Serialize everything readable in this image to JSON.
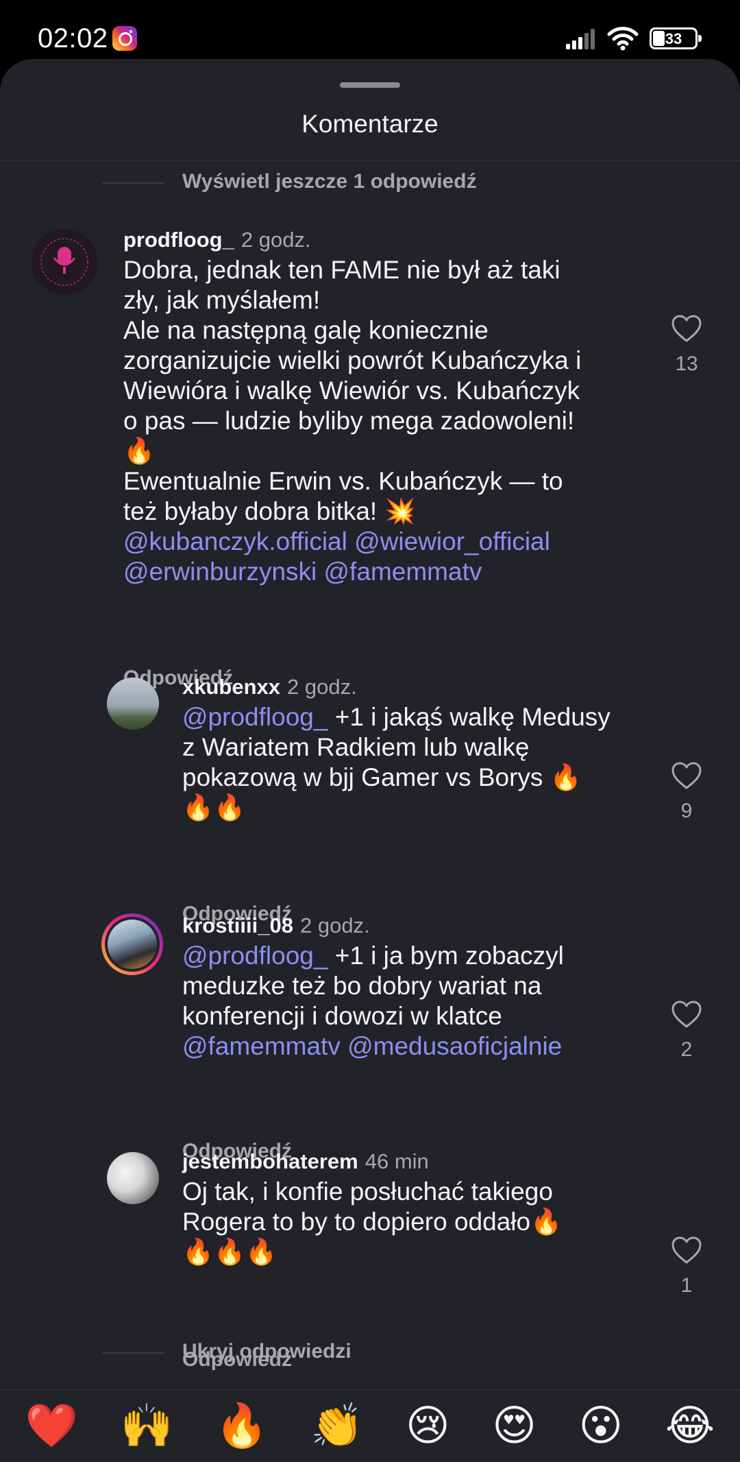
{
  "status_bar": {
    "time": "02:02",
    "battery": "33"
  },
  "sheet": {
    "title": "Komentarze"
  },
  "view_more": "Wyświetl jeszcze 1 odpowiedź",
  "hide_replies": "Ukryj odpowiedzi",
  "comments": [
    {
      "username": "prodfloog_",
      "time": "2 godz.",
      "lines": [
        {
          "text": "Dobra, jednak ten FAME nie był aż taki"
        },
        {
          "text": "zły, jak myślałem!"
        },
        {
          "text": "Ale na następną galę koniecznie"
        },
        {
          "text": "zorganizujcie wielki powrót Kubańczyka i"
        },
        {
          "text": "Wiewióra i walkę Wiewiór vs. Kubańczyk"
        },
        {
          "text": "o pas — ludzie byliby mega zadowoleni!"
        },
        {
          "text": "🔥"
        },
        {
          "text": "Ewentualnie Erwin vs. Kubańczyk — to"
        },
        {
          "text": "też byłaby dobra  bitka! 💥"
        },
        {
          "text": "@kubanczyk.official @wiewior_official",
          "mention": true
        },
        {
          "text": "@erwinburzynski @famemmatv",
          "mention": true
        }
      ],
      "reply_label": "Odpowiedź",
      "likes": "13"
    },
    {
      "username": "xkubenxx",
      "time": "2 godz.",
      "mention": "@prodfloog_",
      "lines": [
        {
          "text": " +1 i jakąś walkę Medusy"
        },
        {
          "text": "z Wariatem Radkiem lub walkę"
        },
        {
          "text": "pokazową w bjj Gamer vs Borys 🔥"
        },
        {
          "text": "🔥🔥"
        }
      ],
      "reply_label": "Odpowiedź",
      "likes": "9"
    },
    {
      "username": "krostiiii_08",
      "time": "2 godz.",
      "mention": "@prodfloog_",
      "lines": [
        {
          "text": " +1 i ja bym zobaczyl"
        },
        {
          "text": "meduzke też bo dobry wariat na"
        },
        {
          "text": "konferencji i dowozi w klatce"
        },
        {
          "text": "@famemmatv @medusaoficjalnie",
          "mention": true
        }
      ],
      "reply_label": "Odpowiedź",
      "likes": "2"
    },
    {
      "username": "jestembohaterem",
      "time": "46 min",
      "lines": [
        {
          "text": "Oj tak, i konfie posłuchać takiego"
        },
        {
          "text": "Rogera to by to dopiero oddało🔥"
        },
        {
          "text": "🔥🔥🔥"
        }
      ],
      "reply_label": "Odpowiedź",
      "likes": "1"
    }
  ],
  "emoji_bar": [
    "❤️",
    "🙌",
    "🔥",
    "👏",
    "😢",
    "😍",
    "😮",
    "😂"
  ],
  "colors": {
    "background": "#212328",
    "mention": "#8e8ef5",
    "muted": "#a6a8ad"
  }
}
